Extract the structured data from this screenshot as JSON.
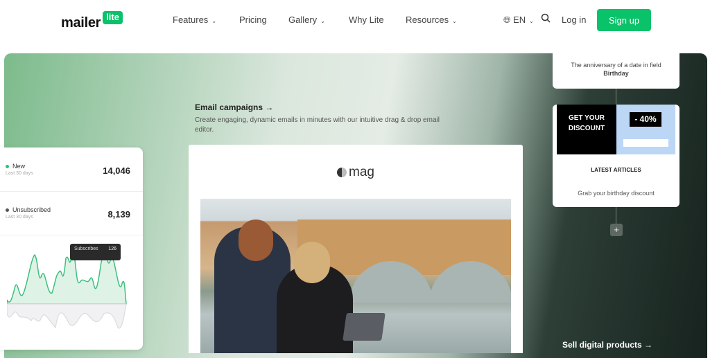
{
  "nav": {
    "logo_text": "mailer",
    "logo_badge": "lite",
    "items": [
      {
        "label": "Features",
        "dropdown": true
      },
      {
        "label": "Pricing",
        "dropdown": false
      },
      {
        "label": "Gallery",
        "dropdown": true
      },
      {
        "label": "Why Lite",
        "dropdown": false
      },
      {
        "label": "Resources",
        "dropdown": true
      }
    ],
    "language": "EN",
    "login": "Log in",
    "signup": "Sign up"
  },
  "hero": {
    "campaign_title": "Email campaigns →",
    "campaign_desc": "Create engaging, dynamic emails in minutes with our intuitive drag & drop email editor.",
    "sell_link": "Sell digital products →"
  },
  "stats": {
    "rows": [
      {
        "label": "New",
        "sub": "Last 30 days",
        "value": "14,046",
        "color": "#2fbf7a"
      },
      {
        "label": "Unsubscribed",
        "sub": "Last 30 days",
        "value": "8,139",
        "color": "#555555"
      }
    ],
    "tooltip": {
      "label": "Subscribes",
      "value": "126"
    }
  },
  "email": {
    "brand": "mag"
  },
  "automation": {
    "trigger_text": "The anniversary of a date in field",
    "trigger_field": "Birthday",
    "promo_title_1": "GET YOUR",
    "promo_title_2": "DISCOUNT",
    "discount": "- 40%",
    "latest": "LATEST ARTICLES",
    "step_label": "Grab your birthday discount",
    "add": "+"
  },
  "colors": {
    "brand": "#09c269"
  }
}
